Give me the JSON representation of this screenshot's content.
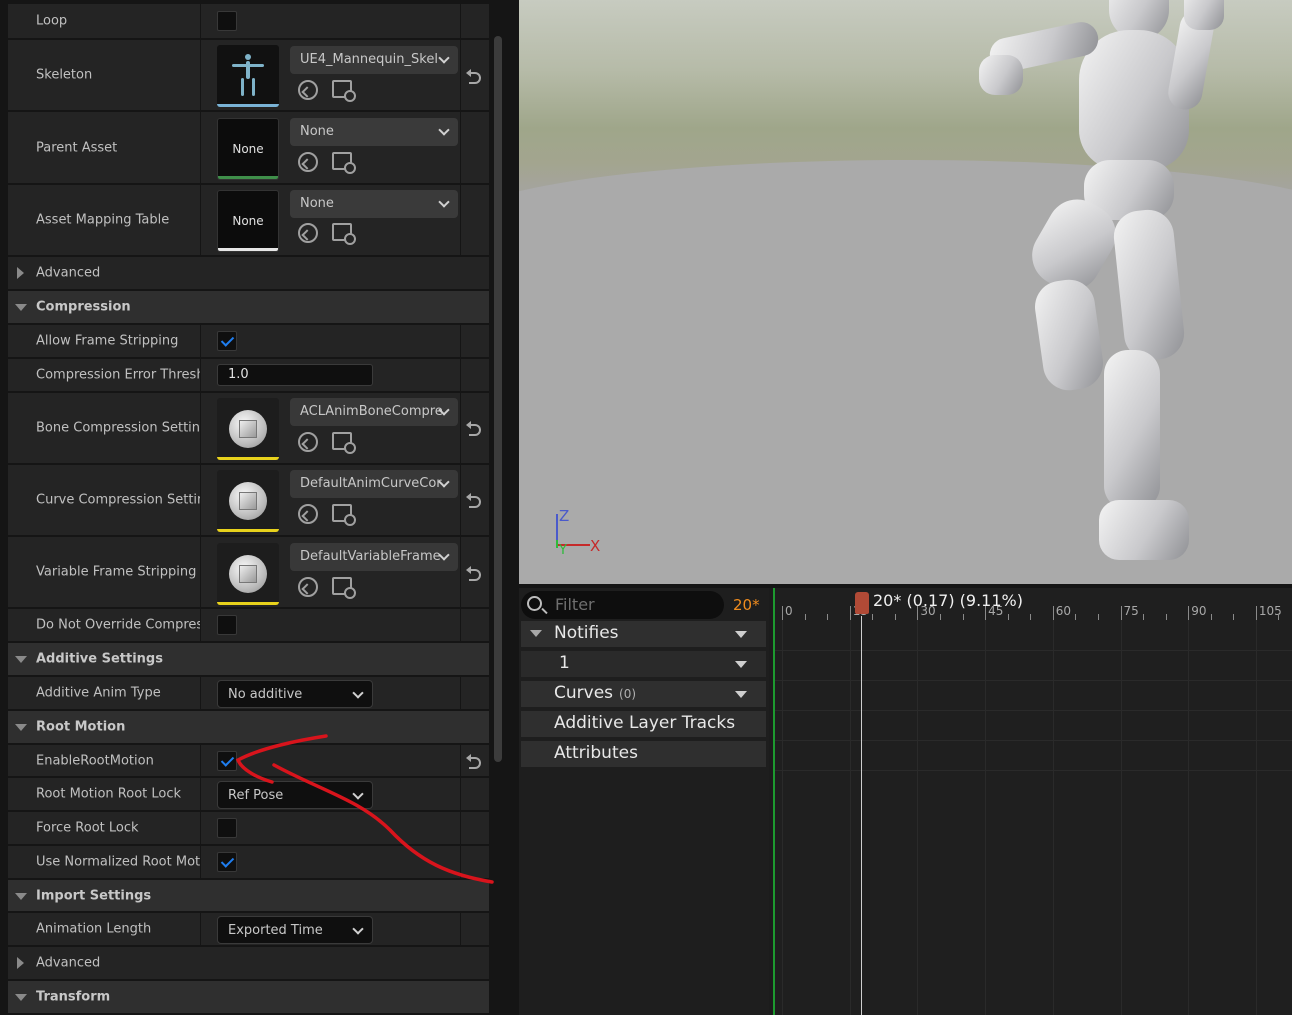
{
  "details": {
    "rows": {
      "loop": "Loop",
      "skeleton": "Skeleton",
      "skeleton_value": "UE4_Mannequin_Skel",
      "parent_asset": "Parent Asset",
      "parent_value": "None",
      "parent_thumb": "None",
      "asset_mapping": "Asset Mapping Table",
      "mapping_value": "None",
      "mapping_thumb": "None",
      "advanced1": "Advanced",
      "compression": "Compression",
      "allow_frame_stripping": "Allow Frame Stripping",
      "compression_error": "Compression Error Thresh...",
      "compression_error_value": "1.0",
      "bone_compression": "Bone Compression Settings",
      "bone_compression_value": "ACLAnimBoneCompre",
      "curve_compression": "Curve Compression Settings",
      "curve_compression_value": "DefaultAnimCurveCor",
      "variable_frame": "Variable Frame Stripping S...",
      "variable_frame_value": "DefaultVariableFrame",
      "do_not_override": "Do Not Override Compress...",
      "additive_settings": "Additive Settings",
      "additive_anim_type": "Additive Anim Type",
      "additive_anim_value": "No additive",
      "root_motion": "Root Motion",
      "enable_root_motion": "EnableRootMotion",
      "root_motion_lock": "Root Motion Root Lock",
      "root_motion_lock_value": "Ref Pose",
      "force_root_lock": "Force Root Lock",
      "use_normalized": "Use Normalized Root Moti...",
      "import_settings": "Import Settings",
      "animation_length": "Animation Length",
      "animation_length_value": "Exported Time",
      "advanced2": "Advanced",
      "transform": "Transform"
    },
    "checkboxes": {
      "loop": false,
      "allow_frame_stripping": true,
      "do_not_override": false,
      "enable_root_motion": true,
      "force_root_lock": false,
      "use_normalized": true
    }
  },
  "viewport": {
    "axis_z": "Z",
    "axis_x": "X",
    "axis_y": "Y"
  },
  "timeline": {
    "filter_placeholder": "Filter",
    "frame_counter": "20*",
    "playhead_label": "20* (0.17) (9.11%)",
    "tracks": {
      "notifies": "Notifies",
      "notify_track": "1",
      "curves": "Curves",
      "curves_count": "(0)",
      "additive_layer": "Additive Layer Tracks",
      "attributes": "Attributes"
    },
    "ticks": [
      "0",
      "15",
      "30",
      "45",
      "60",
      "75",
      "90",
      "105"
    ]
  },
  "colors": {
    "accent_blue": "#1f7ef0",
    "frame_orange": "#f08c1e",
    "annotation_red": "#d8141c"
  }
}
